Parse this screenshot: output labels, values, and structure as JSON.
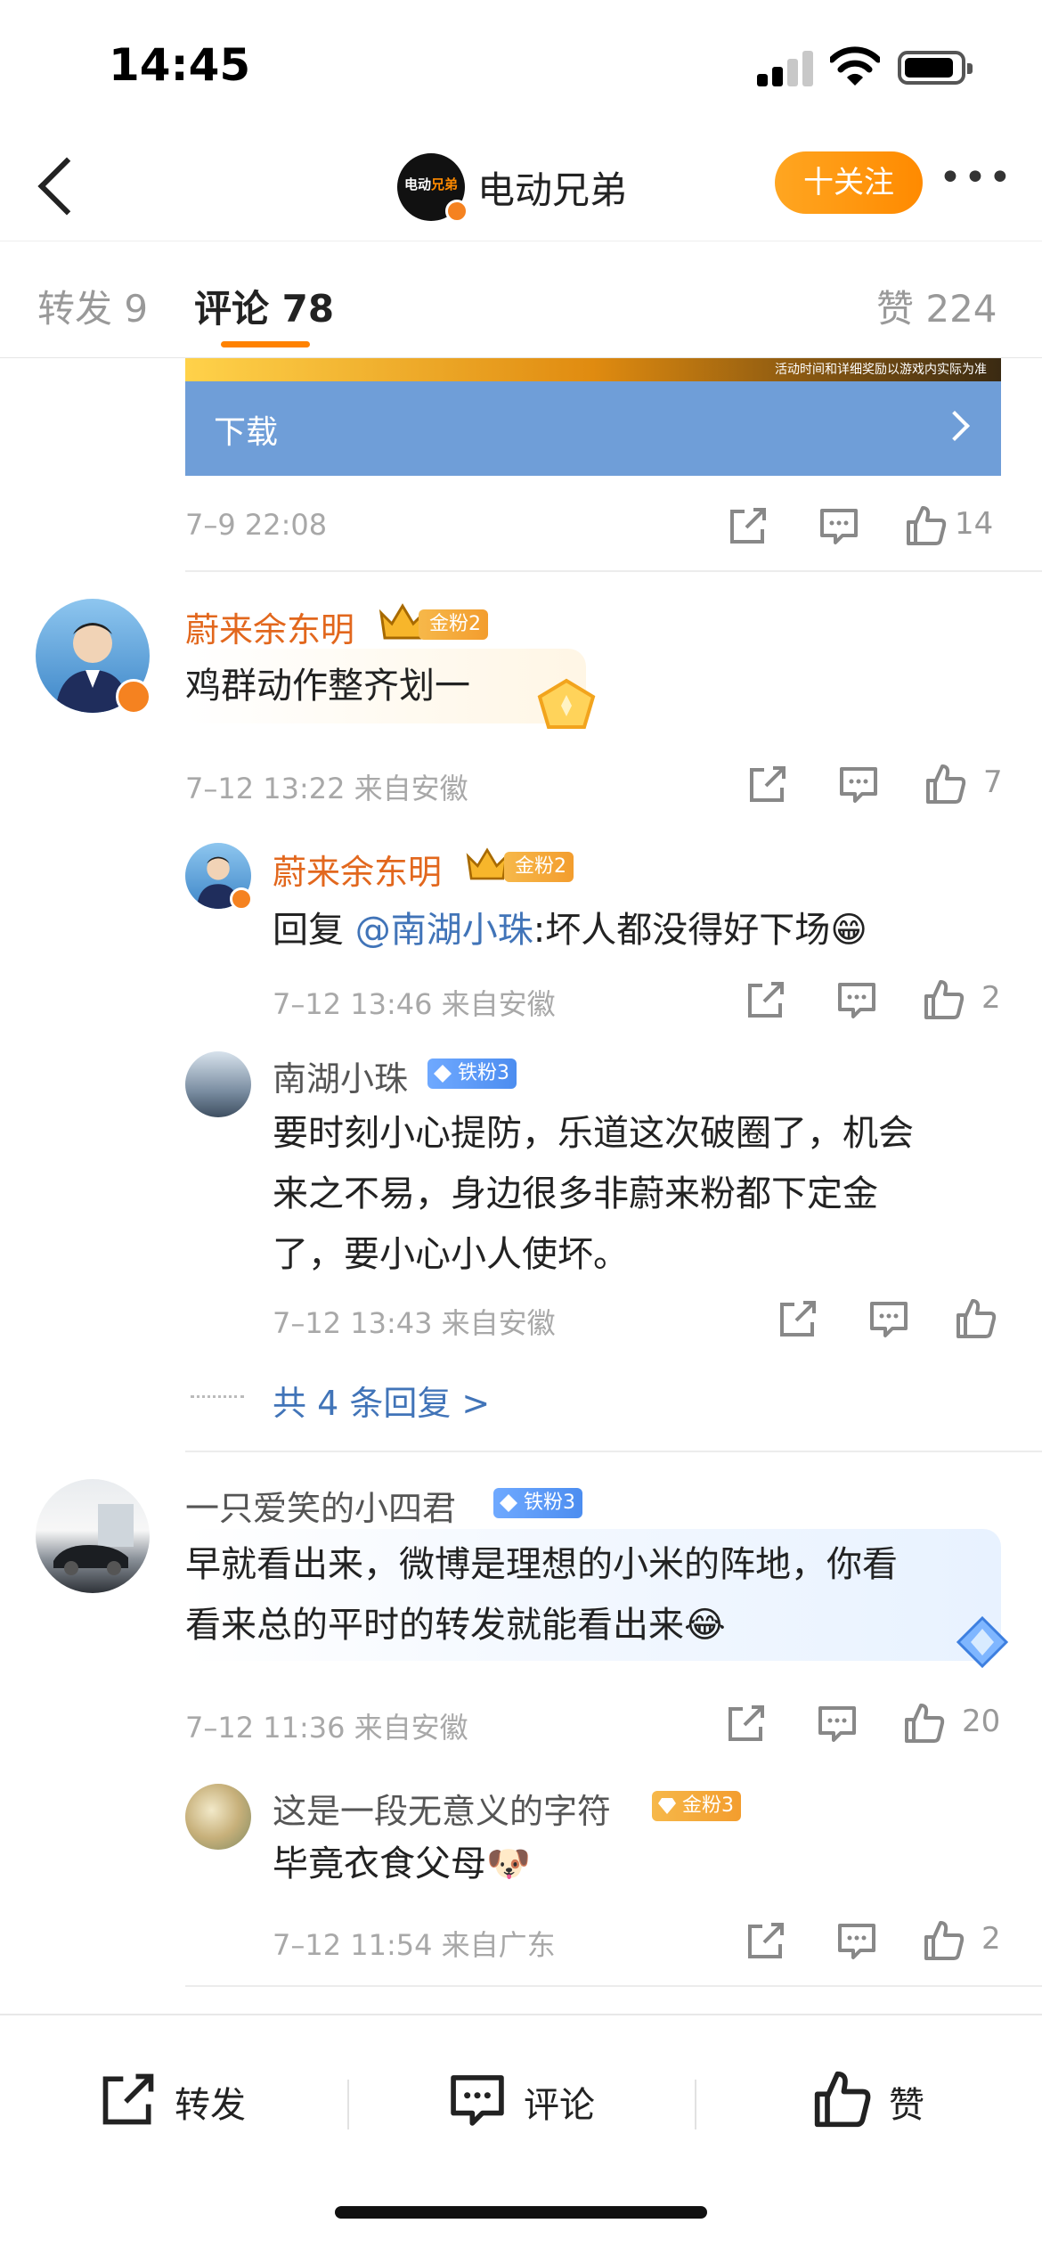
{
  "status_bar": {
    "time": "14:45"
  },
  "nav": {
    "title": "电动兄弟",
    "follow_label": "十关注",
    "more_label": "•••",
    "avatar_text_a": "电动",
    "avatar_text_b": "兄弟"
  },
  "tabs": {
    "repost": "转发 9",
    "comments": "评论 78",
    "likes": "赞 224"
  },
  "top_card": {
    "banner_small_text": "活动时间和详细奖励以游戏内实际为准",
    "download_label": "下载",
    "time": "7–9 22:08",
    "like_count": "14"
  },
  "comments": [
    {
      "user": "蔚来余东明",
      "badge": "金粉2",
      "text": "鸡群动作整齐划一",
      "meta": "7–12 13:22  来自安徽",
      "likes": "7",
      "replies": [
        {
          "user": "蔚来余东明",
          "badge": "金粉2",
          "reply_prefix": "回复",
          "mention": "@南湖小珠",
          "text": ":坏人都没得好下场",
          "emoji": "😁",
          "meta": "7–12 13:46  来自安徽",
          "likes": "2"
        },
        {
          "user": "南湖小珠",
          "badge": "铁粉3",
          "line1": "要时刻小心提防，乐道这次破圈了，机会",
          "line2": "来之不易，身边很多非蔚来粉都下定金",
          "line3": "了，要小心小人使坏。",
          "meta": "7–12 13:43  来自安徽"
        }
      ],
      "more_replies": "共 4 条回复 >"
    },
    {
      "user": "一只爱笑的小四君",
      "badge": "铁粉3",
      "line1": "早就看出来，微博是理想的小米的阵地，你看",
      "line2": "看来总的平时的转发就能看出来",
      "emoji": "😂",
      "meta": "7–12 11:36  来自安徽",
      "likes": "20",
      "replies": [
        {
          "user": "这是一段无意义的字符",
          "badge": "金粉3",
          "text": "毕竟衣食父母",
          "emoji": "🐶",
          "meta": "7–12 11:54  来自广东",
          "likes": "2"
        }
      ]
    }
  ],
  "bottom_bar": {
    "repost": "转发",
    "comment": "评论",
    "like": "赞"
  },
  "colors": {
    "accent": "#ff8200",
    "link": "#4174b8",
    "username_orange": "#e2671d",
    "gold_badge": "#f6b84a",
    "iron_badge": "#4c8df0"
  }
}
